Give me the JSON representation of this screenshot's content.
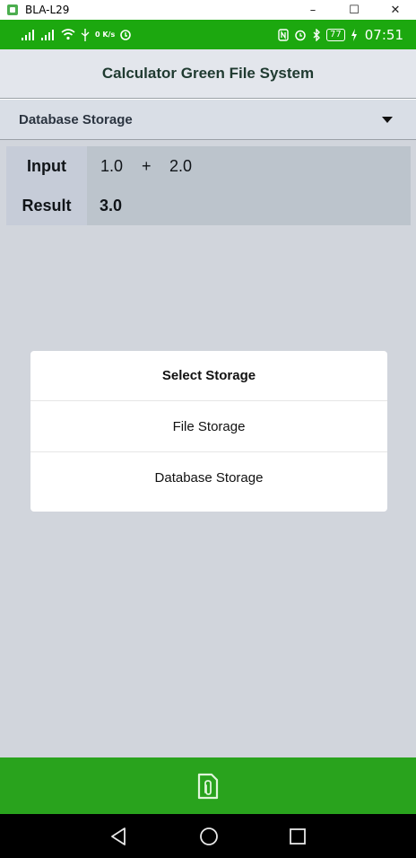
{
  "window": {
    "title": "BLA-L29",
    "minimize_glyph": "–",
    "maximize_glyph": "☐",
    "close_glyph": "✕"
  },
  "status_bar": {
    "network_label": "0 K/s",
    "battery_level": "77",
    "time": "07:51",
    "bg_color": "#1ca80f"
  },
  "app_bar": {
    "title": "Calculator Green File System"
  },
  "storage_spinner": {
    "selected": "Database Storage"
  },
  "calculator": {
    "input_label": "Input",
    "result_label": "Result",
    "operand_a": "1.0",
    "operator": "+",
    "operand_b": "2.0",
    "result": "3.0"
  },
  "dialog": {
    "title": "Select Storage",
    "options": [
      "File Storage",
      "Database Storage"
    ]
  },
  "action_bar": {
    "icon": "file-attachment-icon",
    "bg_color": "#29a31d"
  },
  "nav_bar": {
    "back_icon": "back-triangle-icon",
    "home_icon": "home-circle-icon",
    "recents_icon": "recents-square-icon"
  }
}
